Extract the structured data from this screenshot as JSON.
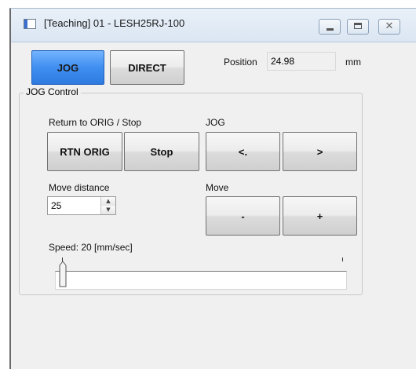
{
  "window": {
    "title": "[Teaching] 01 - LESH25RJ-100",
    "close_glyph": "✕"
  },
  "mode_buttons": {
    "jog": "JOG",
    "direct": "DIRECT"
  },
  "position": {
    "label": "Position",
    "value": "24.98",
    "unit": "mm"
  },
  "jog_control": {
    "title": "JOG Control",
    "return_label": "Return to ORIG / Stop",
    "rtn_orig": "RTN ORIG",
    "stop": "Stop",
    "jog_label": "JOG",
    "jog_minus": "<.",
    "jog_plus": ">",
    "move_distance_label": "Move distance",
    "move_distance_value": "25",
    "move_label": "Move",
    "move_minus": "-",
    "move_plus": "+",
    "speed_label": "Speed:  20 [mm/sec]",
    "speed_fraction": 0.0
  },
  "colors": {
    "active_button": "#3f8ef0",
    "window_bg": "#f0f0f0"
  },
  "icons": [
    "app-icon",
    "minimize-icon",
    "maximize-icon",
    "close-icon",
    "spin-up-icon",
    "spin-down-icon"
  ]
}
